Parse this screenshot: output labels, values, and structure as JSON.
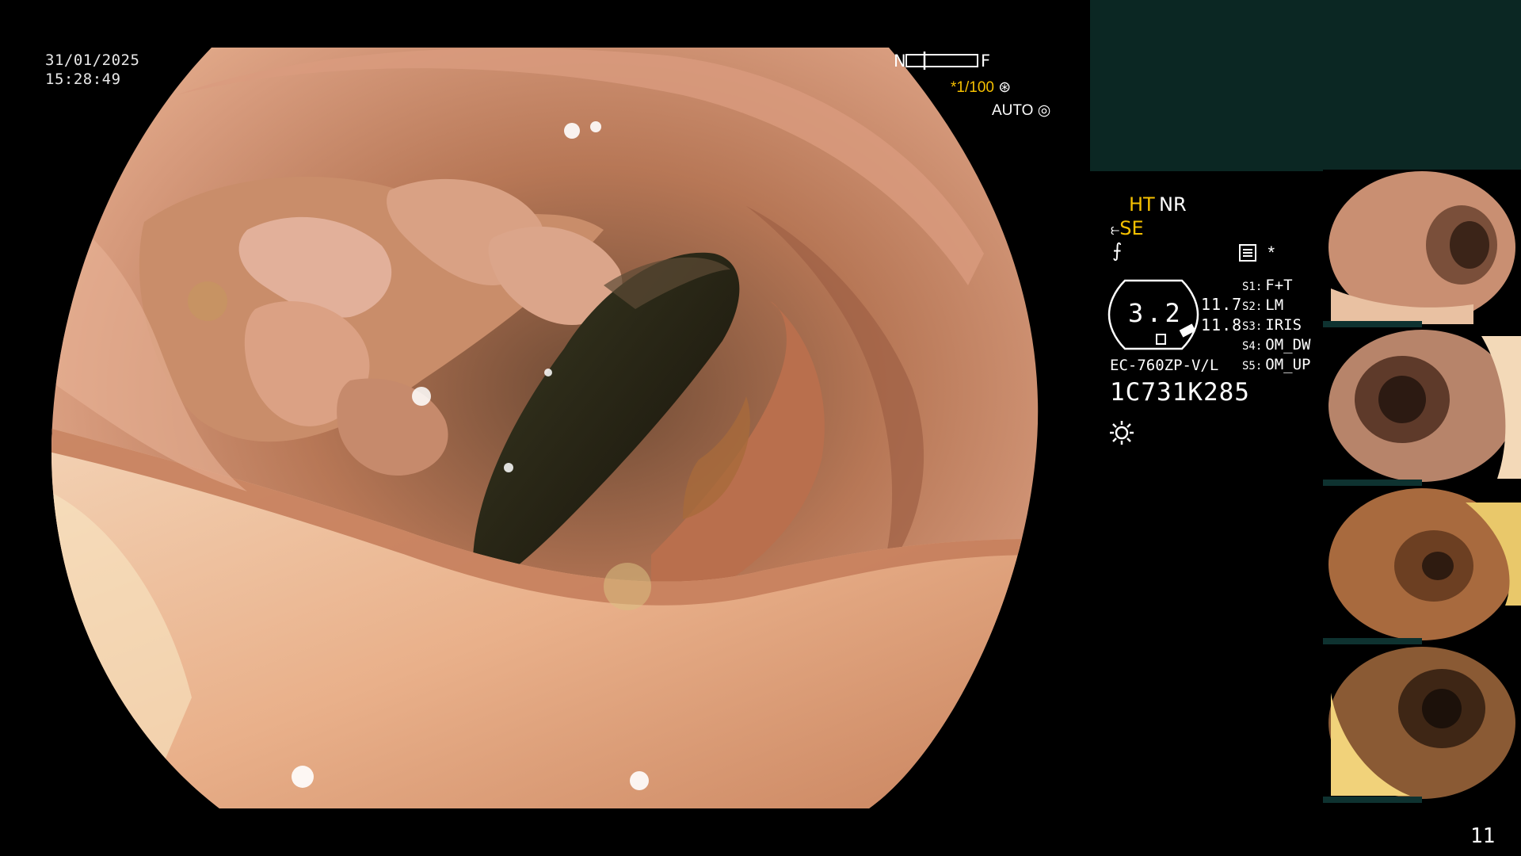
{
  "overlay": {
    "date": "31/01/2025",
    "time": "15:28:49",
    "nf_near": "N",
    "nf_far": "F",
    "shutter_prefix": "*",
    "shutter": "1/100",
    "auto": "AUTO"
  },
  "settings": {
    "ht": "HT",
    "nr": "NR",
    "se": "SE",
    "zoom": "3.2",
    "zoom_side_a": "11.7",
    "zoom_side_b": "11.8",
    "scope_model": "EC-760ZP-V/L",
    "serial": "1C731K285",
    "asterisk": "*"
  },
  "switches": [
    {
      "key": "S1:",
      "value": "F+T"
    },
    {
      "key": "S2:",
      "value": "LM"
    },
    {
      "key": "S3:",
      "value": "IRIS"
    },
    {
      "key": "S4:",
      "value": "OM_DW"
    },
    {
      "key": "S5:",
      "value": "OM_UP"
    }
  ],
  "thumbnails": [
    {
      "name": "capture 1"
    },
    {
      "name": "capture 2"
    },
    {
      "name": "capture 3"
    },
    {
      "name": "capture 4"
    }
  ],
  "page_number": "11",
  "colors": {
    "accent_yellow": "#f5c000",
    "panel_teal": "#0b2723",
    "mucosa": "#c98a6a"
  }
}
